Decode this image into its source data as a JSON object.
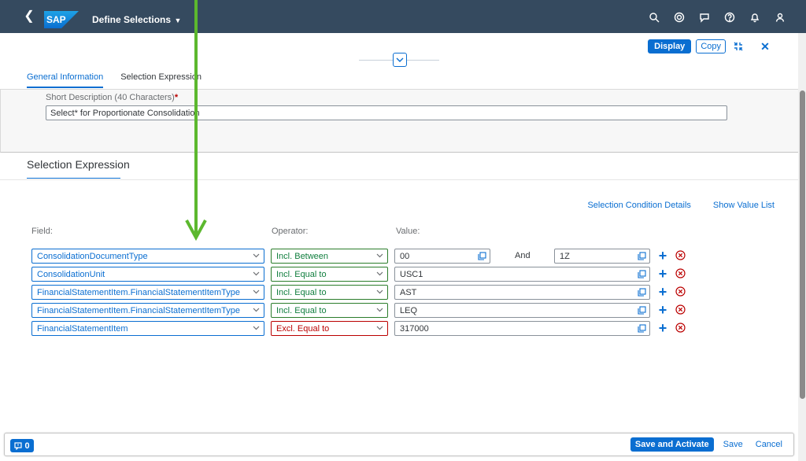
{
  "shell": {
    "title": "Define Selections",
    "icons": [
      "back-icon",
      "search-icon",
      "copilot-icon",
      "feedback-icon",
      "help-icon",
      "notifications-icon",
      "user-icon"
    ]
  },
  "header": {
    "display_label": "Display",
    "copy_label": "Copy",
    "tabs": [
      {
        "label": "General Information",
        "active": true
      },
      {
        "label": "Selection Expression",
        "active": false
      }
    ]
  },
  "general": {
    "short_desc_label": "Short Description (40 Characters)",
    "required_marker": "*",
    "short_desc_value": "Select* for Proportionate Consolidation"
  },
  "selection": {
    "title": "Selection Expression",
    "link_details": "Selection Condition Details",
    "link_values": "Show Value List",
    "col_field": "Field:",
    "col_operator": "Operator:",
    "col_value": "Value:",
    "and_label": "And",
    "rows": [
      {
        "field": "ConsolidationDocumentType",
        "operator": "Incl. Between",
        "value": "00",
        "value_to": "1Z"
      },
      {
        "field": "ConsolidationUnit",
        "operator": "Incl. Equal to",
        "value": "USC1"
      },
      {
        "field": "FinancialStatementItem.FinancialStatementItemType",
        "operator": "Incl. Equal to",
        "value": "AST"
      },
      {
        "field": "FinancialStatementItem.FinancialStatementItemType",
        "operator": "Incl. Equal to",
        "value": "LEQ"
      },
      {
        "field": "FinancialStatementItem",
        "operator": "Excl. Equal to",
        "value": "317000"
      }
    ]
  },
  "footer": {
    "message_count": "0",
    "save_activate": "Save and Activate",
    "save": "Save",
    "cancel": "Cancel"
  },
  "colors": {
    "shell": "#354a5f",
    "accent": "#0a6ed1",
    "include": "#107e3e",
    "exclude": "#bb0000",
    "annotation_arrow": "#5cb82e"
  }
}
